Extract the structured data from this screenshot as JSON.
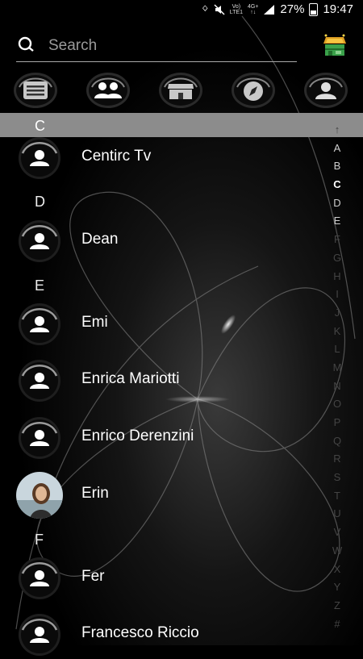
{
  "status_bar": {
    "network_top": "Vo)",
    "network_bottom": "LTE1",
    "data_top": "4G+",
    "battery": "27%",
    "time": "19:47"
  },
  "search": {
    "placeholder": "Search"
  },
  "tabs": [
    {
      "icon": "chat-icon"
    },
    {
      "icon": "contacts-icon"
    },
    {
      "icon": "store-icon"
    },
    {
      "icon": "compass-icon"
    },
    {
      "icon": "profile-icon"
    }
  ],
  "sections": [
    {
      "letter": "C",
      "contacts": [
        {
          "name": "Centirc Tv"
        }
      ]
    },
    {
      "letter": "D",
      "contacts": [
        {
          "name": "Dean"
        }
      ]
    },
    {
      "letter": "E",
      "contacts": [
        {
          "name": "Emi"
        },
        {
          "name": "Enrica Mariotti"
        },
        {
          "name": "Enrico Derenzini"
        },
        {
          "name": "Erin",
          "has_photo": true
        }
      ]
    },
    {
      "letter": "F",
      "contacts": [
        {
          "name": "Fer"
        },
        {
          "name": "Francesco Riccio"
        }
      ]
    }
  ],
  "index_letters": [
    "↑",
    "A",
    "B",
    "C",
    "D",
    "E",
    "F",
    "G",
    "H",
    "I",
    "J",
    "K",
    "L",
    "M",
    "N",
    "O",
    "P",
    "Q",
    "R",
    "S",
    "T",
    "U",
    "V",
    "W",
    "X",
    "Y",
    "Z",
    "#"
  ],
  "index_current": "C",
  "colors": {
    "background": "#000000",
    "active_header": "#8c8c8c",
    "text": "#ffffff"
  }
}
